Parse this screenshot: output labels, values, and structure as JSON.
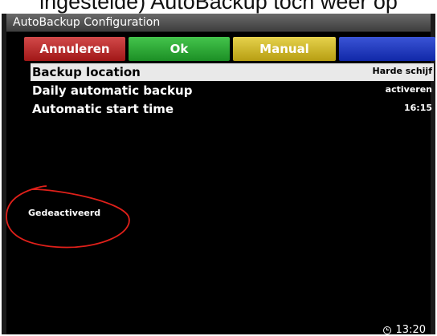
{
  "caption": "ingestelde) AutoBackup toch weer op",
  "window": {
    "title": "AutoBackup Configuration"
  },
  "buttons": {
    "red": "Annuleren",
    "green": "Ok",
    "yellow": "Manual",
    "blue": ""
  },
  "settings": [
    {
      "label": "Backup location",
      "value": "Harde schijf",
      "selected": true
    },
    {
      "label": "Daily automatic backup",
      "value": "activeren",
      "selected": false
    },
    {
      "label": "Automatic start time",
      "value": "16:15",
      "selected": false
    }
  ],
  "status": "Gedeactiveerd",
  "clock": {
    "time": "13:20",
    "icon": "clock-icon"
  },
  "colors": {
    "red": "#b42323",
    "green": "#2aa335",
    "yellow": "#cdb626",
    "blue": "#1f3ac2",
    "annotation": "#e0201a"
  }
}
